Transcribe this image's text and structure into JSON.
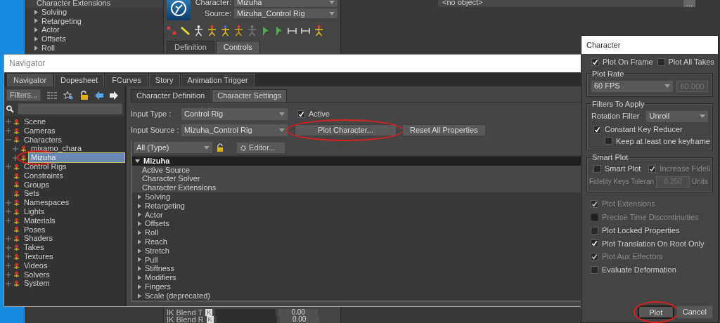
{
  "background_app": {
    "property_list": [
      {
        "label": "Character Extensions",
        "kind": "leaf"
      },
      {
        "label": "Solving",
        "kind": "group",
        "expanded": false
      },
      {
        "label": "Retargeting",
        "kind": "group",
        "expanded": false
      },
      {
        "label": "Actor",
        "kind": "group",
        "expanded": false
      },
      {
        "label": "Offsets",
        "kind": "group",
        "expanded": false
      },
      {
        "label": "Roll",
        "kind": "group",
        "expanded": false
      }
    ],
    "character_field": {
      "label": "Character:",
      "value": "Mizuha"
    },
    "source_field": {
      "label": "Source:",
      "value": "Mizuha_Control Rig"
    },
    "tabs": [
      {
        "label": "Definition",
        "selected": false
      },
      {
        "label": "Controls",
        "selected": true
      }
    ],
    "object_field": {
      "value": "<no object>",
      "button": "..."
    },
    "ik_rows": [
      {
        "label": "IK Blend T",
        "key": "K",
        "value": "0.00"
      },
      {
        "label": "IK Blend R",
        "key": "K",
        "value": "0.00"
      }
    ]
  },
  "navigator": {
    "title": "Navigator",
    "tabs": [
      {
        "label": "Navigator",
        "selected": true
      },
      {
        "label": "Dopesheet",
        "selected": false
      },
      {
        "label": "FCurves",
        "selected": false
      },
      {
        "label": "Story",
        "selected": false
      },
      {
        "label": "Animation Trigger",
        "selected": false
      }
    ],
    "filters_button": "Filters...",
    "tree": [
      {
        "label": "Scene",
        "expanded": false,
        "selected": false,
        "circled": false
      },
      {
        "label": "Cameras",
        "expanded": false,
        "selected": false,
        "circled": false
      },
      {
        "label": "Characters",
        "expanded": true,
        "selected": false,
        "circled": false,
        "children": [
          {
            "label": "mixamo_chara",
            "expanded": false,
            "selected": false,
            "circled": false
          },
          {
            "label": "Mizuha",
            "expanded": false,
            "selected": true,
            "circled": true
          }
        ]
      },
      {
        "label": "Control Rigs",
        "expanded": false,
        "selected": false,
        "circled": false
      },
      {
        "label": "Constraints",
        "selected": false,
        "circled": false
      },
      {
        "label": "Groups",
        "selected": false,
        "circled": false
      },
      {
        "label": "Sets",
        "selected": false,
        "circled": false
      },
      {
        "label": "Namespaces",
        "expanded": false,
        "selected": false,
        "circled": false
      },
      {
        "label": "Lights",
        "expanded": false,
        "selected": false,
        "circled": false
      },
      {
        "label": "Materials",
        "expanded": false,
        "selected": false,
        "circled": false
      },
      {
        "label": "Poses",
        "selected": false,
        "circled": false
      },
      {
        "label": "Shaders",
        "expanded": false,
        "selected": false,
        "circled": false
      },
      {
        "label": "Takes",
        "expanded": false,
        "selected": false,
        "circled": false
      },
      {
        "label": "Textures",
        "expanded": false,
        "selected": false,
        "circled": false
      },
      {
        "label": "Videos",
        "expanded": false,
        "selected": false,
        "circled": false
      },
      {
        "label": "Solvers",
        "expanded": false,
        "selected": false,
        "circled": false
      },
      {
        "label": "System",
        "expanded": false,
        "selected": false,
        "circled": false
      }
    ],
    "view_tabs": [
      {
        "label": "Character Definition",
        "selected": false
      },
      {
        "label": "Character Settings",
        "selected": true
      }
    ],
    "input_type": {
      "label": "Input Type :",
      "value": "Control Rig"
    },
    "active": {
      "label": "Active",
      "checked": true
    },
    "input_source": {
      "label": "Input Source :",
      "value": "Mizuha_Control Rig"
    },
    "buttons": [
      {
        "label": "Plot Character...",
        "circled": true
      },
      {
        "label": "Reset All Properties",
        "circled": false
      }
    ],
    "filter": {
      "value": "All (Type)"
    },
    "editor_button": "Editor...",
    "properties": {
      "title": "Mizuha",
      "expanded": true,
      "items": [
        {
          "label": "Active Source",
          "kind": "leaf"
        },
        {
          "label": "Character Solver",
          "kind": "leaf"
        },
        {
          "label": "Character Extensions",
          "kind": "leaf"
        },
        {
          "label": "Solving",
          "kind": "group",
          "expanded": false
        },
        {
          "label": "Retargeting",
          "kind": "group",
          "expanded": false
        },
        {
          "label": "Actor",
          "kind": "group",
          "expanded": false
        },
        {
          "label": "Offsets",
          "kind": "group",
          "expanded": false
        },
        {
          "label": "Roll",
          "kind": "group",
          "expanded": false
        },
        {
          "label": "Reach",
          "kind": "group",
          "expanded": false
        },
        {
          "label": "Stretch",
          "kind": "group",
          "expanded": false
        },
        {
          "label": "Pull",
          "kind": "group",
          "expanded": false
        },
        {
          "label": "Stiffness",
          "kind": "group",
          "expanded": false
        },
        {
          "label": "Modifiers",
          "kind": "group",
          "expanded": false
        },
        {
          "label": "Fingers",
          "kind": "group",
          "expanded": false
        },
        {
          "label": "Scale (deprecated)",
          "kind": "group",
          "expanded": false
        }
      ]
    }
  },
  "dialog": {
    "title": "Character",
    "top_options": [
      {
        "label": "Plot On Frame",
        "checked": true
      },
      {
        "label": "Plot All Takes",
        "checked": false
      }
    ],
    "plot_rate": {
      "title": "Plot Rate",
      "value": "60 FPS",
      "rate": "60.000"
    },
    "filters": {
      "title": "Filters To Apply",
      "rotation_label": "Rotation Filter",
      "rotation_value": "Unroll",
      "options": [
        {
          "label": "Constant Key Reducer",
          "checked": true,
          "children": [
            {
              "label": "Keep at least one keyframe",
              "checked": false
            }
          ]
        }
      ]
    },
    "smart_plot": {
      "title": "Smart Plot",
      "options": [
        {
          "label": "Smart Plot",
          "checked": false,
          "disabled": false
        },
        {
          "label": "Increase Fideli",
          "checked": true,
          "disabled": true
        }
      ],
      "tolerance_label": "Fidelity Keys Toleran",
      "tolerance_value": "0.250",
      "units": "Units"
    },
    "options": [
      {
        "label": "Plot Extensions",
        "checked": true,
        "disabled": true
      },
      {
        "label": "Precise Time Discontinuities",
        "checked": false,
        "disabled": true
      },
      {
        "label": "Plot Locked Properties",
        "checked": false,
        "disabled": false
      },
      {
        "label": "Plot Translation On Root Only",
        "checked": true,
        "disabled": false
      },
      {
        "label": "Plot Aux Effectors",
        "checked": true,
        "disabled": true
      },
      {
        "label": "Evaluate Deformation",
        "checked": false,
        "disabled": false
      }
    ],
    "buttons": [
      {
        "label": "Plot",
        "default": true,
        "circled": true
      },
      {
        "label": "Cancel",
        "default": false,
        "circled": false
      }
    ]
  }
}
